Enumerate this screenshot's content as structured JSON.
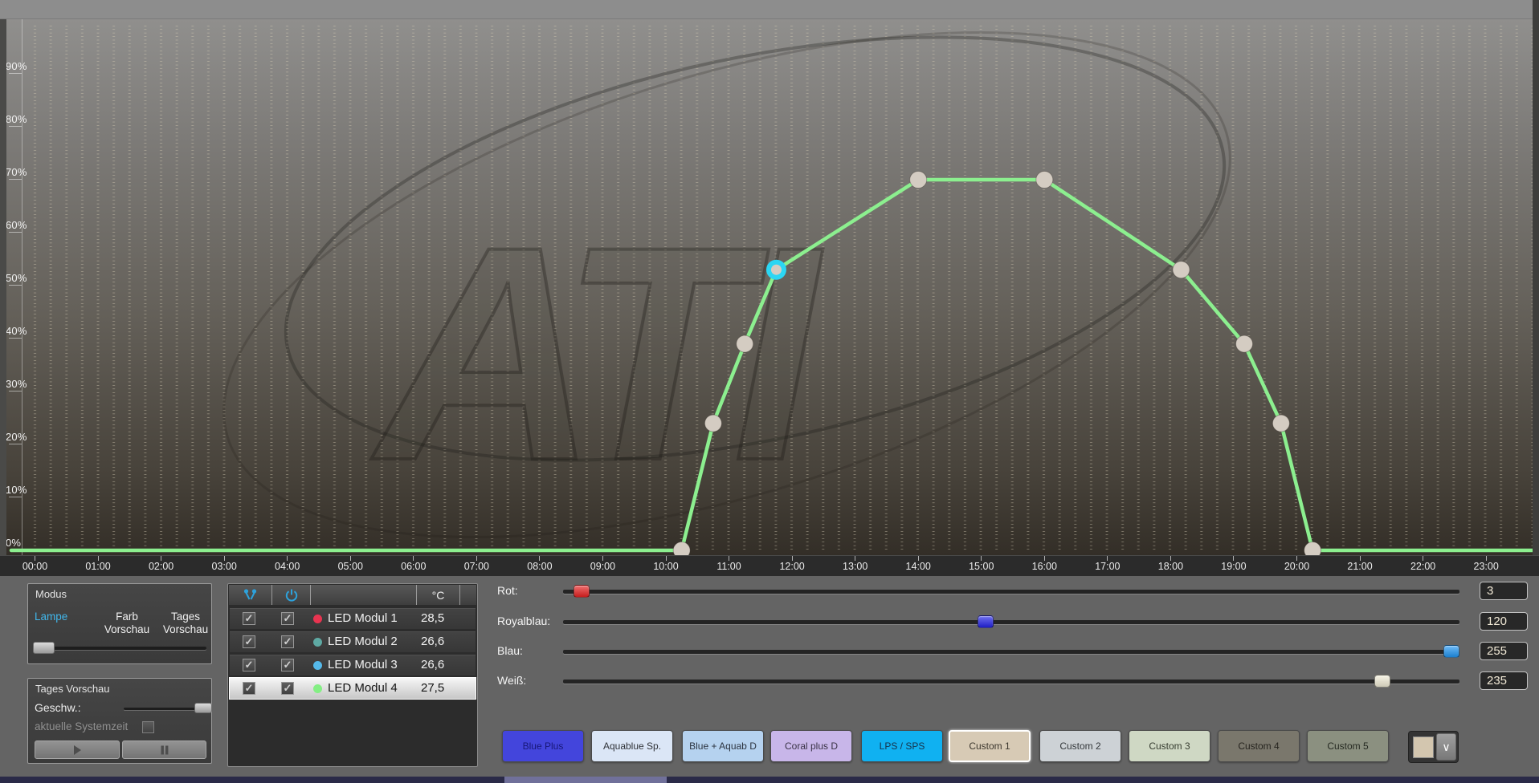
{
  "chart_data": {
    "type": "line",
    "title": "",
    "watermark": "ATI",
    "x_ticks": [
      "00:00",
      "01:00",
      "02:00",
      "03:00",
      "04:00",
      "05:00",
      "06:00",
      "07:00",
      "08:00",
      "09:00",
      "10:00",
      "11:00",
      "12:00",
      "13:00",
      "14:00",
      "15:00",
      "16:00",
      "17:00",
      "18:00",
      "19:00",
      "20:00",
      "21:00",
      "22:00",
      "23:00"
    ],
    "y_ticks": [
      {
        "label": "90%",
        "value": 90
      },
      {
        "label": "80%",
        "value": 80
      },
      {
        "label": "70%",
        "value": 70
      },
      {
        "label": "60%",
        "value": 60
      },
      {
        "label": "50%",
        "value": 50
      },
      {
        "label": "40%",
        "value": 40
      },
      {
        "label": "30%",
        "value": 30
      },
      {
        "label": "20%",
        "value": 20
      },
      {
        "label": "10%",
        "value": 10
      },
      {
        "label": "0%",
        "value": 0
      }
    ],
    "ylim": [
      0,
      100
    ],
    "x_range": [
      "00:00",
      "24:00"
    ],
    "grid": "dotted columns every 15 minutes",
    "series": [
      {
        "name": "LED Modul 4",
        "color": "#8cef8f",
        "marker_color": "#d4ccc2",
        "selected_marker_ring": "#2bd6f3",
        "baseline_percent": 0,
        "points": [
          {
            "time": "10:15",
            "percent": 0
          },
          {
            "time": "10:45",
            "percent": 24
          },
          {
            "time": "11:15",
            "percent": 39
          },
          {
            "time": "11:45",
            "percent": 53,
            "selected": true
          },
          {
            "time": "14:00",
            "percent": 70
          },
          {
            "time": "16:00",
            "percent": 70
          },
          {
            "time": "18:10",
            "percent": 53
          },
          {
            "time": "19:10",
            "percent": 39
          },
          {
            "time": "19:45",
            "percent": 24
          },
          {
            "time": "20:15",
            "percent": 0
          }
        ]
      }
    ]
  },
  "modus": {
    "title": "Modus",
    "active_color": "#41b6ea",
    "options": [
      {
        "label": "Lampe",
        "active": true
      },
      {
        "label": "Farb Vorschau",
        "active": false
      },
      {
        "label": "Tages Vorschau",
        "active": false
      }
    ],
    "slider_position": 0
  },
  "tages_vorschau": {
    "title": "Tages Vorschau",
    "speed_label": "Geschw.:",
    "speed_position": 1,
    "system_time_label": "aktuelle Systemzeit",
    "system_time_checked": false
  },
  "modules": {
    "header": {
      "preview_icon": "link-nodes",
      "power_icon": "power",
      "temp_unit": "°C"
    },
    "rows": [
      {
        "name": "LED Modul 1",
        "temp": "28,5",
        "dot_color": "#e83450",
        "checked1": true,
        "checked2": true,
        "selected": false
      },
      {
        "name": "LED Modul 2",
        "temp": "26,6",
        "dot_color": "#5ea9a3",
        "checked1": true,
        "checked2": true,
        "selected": false
      },
      {
        "name": "LED Modul 3",
        "temp": "26,6",
        "dot_color": "#55b9ea",
        "checked1": true,
        "checked2": true,
        "selected": false
      },
      {
        "name": "LED Modul 4",
        "temp": "27,5",
        "dot_color": "#84ef84",
        "checked1": true,
        "checked2": true,
        "selected": true
      }
    ]
  },
  "channels": [
    {
      "label": "Rot:",
      "value": 3,
      "display": "3",
      "handle_color": "#e82222"
    },
    {
      "label": "Royalblau:",
      "value": 120,
      "display": "120",
      "handle_color": "#2424e8"
    },
    {
      "label": "Blau:",
      "value": 255,
      "display": "255",
      "handle_color": "#2196f3"
    },
    {
      "label": "Weiß:",
      "value": 235,
      "display": "235",
      "handle_color": "#f2edd7"
    }
  ],
  "presets": [
    {
      "label": "Blue Plus",
      "bg": "#4345dc",
      "fg": "#181878",
      "selected": false
    },
    {
      "label": "Aquablue Sp.",
      "bg": "#dbe6f6",
      "fg": "#303338",
      "selected": false
    },
    {
      "label": "Blue + Aquab D",
      "bg": "#b5d2ef",
      "fg": "#2c3440",
      "selected": false
    },
    {
      "label": "Coral plus D",
      "bg": "#c8b6e9",
      "fg": "#3a3346",
      "selected": false
    },
    {
      "label": "LPS / SPS",
      "bg": "#10b1f1",
      "fg": "#17324a",
      "selected": false
    },
    {
      "label": "Custom 1",
      "bg": "#d7cab5",
      "fg": "#3c372e",
      "selected": true
    },
    {
      "label": "Custom 2",
      "bg": "#cdd2d6",
      "fg": "#34383b",
      "selected": false
    },
    {
      "label": "Custom 3",
      "bg": "#cfd8c4",
      "fg": "#363c30",
      "selected": false
    },
    {
      "label": "Custom 4",
      "bg": "#7a776c",
      "fg": "#26241f",
      "selected": false
    },
    {
      "label": "Custom 5",
      "bg": "#8b9080",
      "fg": "#262a22",
      "selected": false
    }
  ],
  "color_picker": {
    "swatch_color": "#d3c6af",
    "chevron": "∨"
  }
}
